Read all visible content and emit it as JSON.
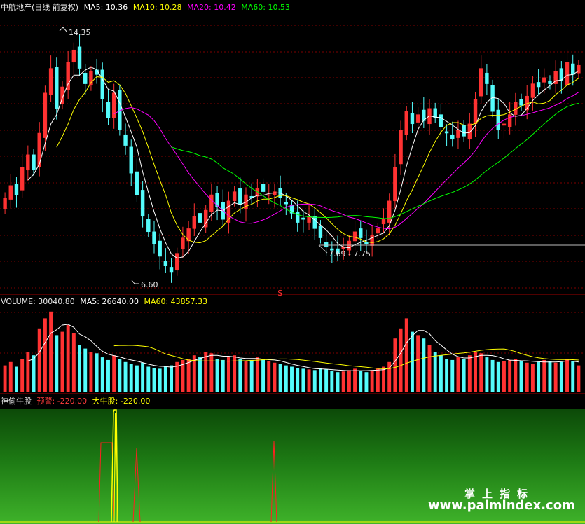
{
  "price_panel": {
    "title": "中航地产(日线 前复权)",
    "ma5_label": "MA5: 10.36",
    "ma10_label": "MA10: 10.28",
    "ma20_label": "MA20: 10.42",
    "ma60_label": "MA60: 10.53",
    "high_annotation": "14.35",
    "low_annotation": "6.60",
    "range_annotation": "7.69 - 7.75",
    "signal_marker": "$"
  },
  "volume_panel": {
    "volume_label": "VOLUME: 30040.80",
    "ma5_label": "MA5: 26640.00",
    "ma60_label": "MA60: 43857.33"
  },
  "indicator_panel": {
    "name_label": "神偷牛股",
    "warn_label": "预警: -220.00",
    "bull_label": "大牛股: -220.00"
  },
  "watermark": {
    "line1": "掌上指标",
    "line2": "www.palmindex.com"
  },
  "colors": {
    "up": "#ff3232",
    "down": "#54fcfc",
    "ma5": "#ffffff",
    "ma10": "#ffff00",
    "ma20": "#ff00ff",
    "ma60": "#00ff00",
    "grid": "#800000",
    "indicator_red": "#ff2020",
    "indicator_yellow": "#ffff00"
  },
  "chart_data": [
    {
      "type": "candlestick",
      "title": "中航地产(日线 前复权)",
      "series": [
        {
          "name": "MA5",
          "value": 10.36
        },
        {
          "name": "MA10",
          "value": 10.28
        },
        {
          "name": "MA20",
          "value": 10.42
        },
        {
          "name": "MA60",
          "value": 10.53
        }
      ],
      "close": [
        9.2,
        9.6,
        9.3,
        10.2,
        10.6,
        10.1,
        11.3,
        12.6,
        13.4,
        12.1,
        12.8,
        13.6,
        14.0,
        13.4,
        12.9,
        13.3,
        13.2,
        12.4,
        11.8,
        12.6,
        11.4,
        10.9,
        10.0,
        9.3,
        8.6,
        8.1,
        7.7,
        7.3,
        7.0,
        6.8,
        7.4,
        7.9,
        8.2,
        8.6,
        8.4,
        8.8,
        9.3,
        8.9,
        8.5,
        9.1,
        9.4,
        9.0,
        9.3,
        9.2,
        9.5,
        9.4,
        9.3,
        9.4,
        9.2,
        9.0,
        8.7,
        8.4,
        8.5,
        8.6,
        8.2,
        7.9,
        7.6,
        7.5,
        7.4,
        7.6,
        7.8,
        8.1,
        7.9,
        7.7,
        8.0,
        8.2,
        8.5,
        9.1,
        10.2,
        11.4,
        12.0,
        11.6,
        11.9,
        11.7,
        12.1,
        11.8,
        11.5,
        11.3,
        11.1,
        11.4,
        11.2,
        11.6,
        12.4,
        13.4,
        12.9,
        12.0,
        11.4,
        11.6,
        11.9,
        12.3,
        12.2,
        12.5,
        12.9,
        12.8,
        13.1,
        12.9,
        13.3,
        13.0,
        13.6,
        13.2,
        13.5
      ],
      "annotations": [
        "14.35",
        "6.60",
        "7.69 - 7.75"
      ],
      "moving_averages": [
        "MA5",
        "MA10",
        "MA20",
        "MA60"
      ]
    },
    {
      "type": "bar",
      "title": "VOLUME: 30040.80",
      "series": [
        {
          "name": "MA5",
          "value": 26640.0
        },
        {
          "name": "MA60",
          "value": 43857.33
        }
      ],
      "values": [
        40,
        45,
        38,
        50,
        60,
        55,
        95,
        110,
        120,
        85,
        90,
        100,
        88,
        70,
        65,
        60,
        58,
        52,
        48,
        55,
        50,
        45,
        42,
        40,
        44,
        38,
        36,
        35,
        38,
        40,
        45,
        48,
        50,
        55,
        52,
        60,
        58,
        50,
        48,
        52,
        55,
        50,
        46,
        48,
        52,
        50,
        46,
        44,
        42,
        40,
        38,
        36,
        35,
        34,
        33,
        36,
        34,
        32,
        30,
        31,
        33,
        35,
        32,
        30,
        33,
        35,
        38,
        45,
        80,
        95,
        110,
        90,
        85,
        80,
        70,
        60,
        55,
        50,
        48,
        52,
        50,
        55,
        60,
        58,
        52,
        48,
        45,
        46,
        48,
        50,
        46,
        44,
        42,
        45,
        48,
        46,
        44,
        45,
        50,
        46,
        40
      ]
    },
    {
      "type": "line",
      "title": "神偷牛股",
      "series": [
        {
          "name": "预警",
          "value": -220.0
        },
        {
          "name": "大牛股",
          "value": -220.0
        }
      ]
    }
  ]
}
